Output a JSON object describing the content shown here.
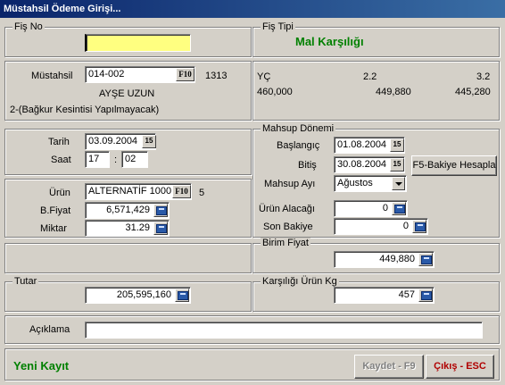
{
  "window": {
    "title": "Müstahsil Ödeme Girişi..."
  },
  "fis_no": {
    "legend": "Fiş No",
    "value": ""
  },
  "fis_tipi": {
    "legend": "Fiş Tipi",
    "value": "Mal Karşılığı"
  },
  "mustahsil": {
    "label": "Müstahsil",
    "code": "014-002",
    "lookup": "F10",
    "id": "1313",
    "name": "AYŞE UZUN",
    "note": "2-(Bağkur Kesintisi Yapılmayacak)"
  },
  "ratios": {
    "h1": "YÇ",
    "h2": "2.2",
    "h3": "3.2",
    "v1": "460,000",
    "v2": "449,880",
    "v3": "445,280"
  },
  "tarih": {
    "label": "Tarih",
    "value": "03.09.2004",
    "cal": "15"
  },
  "saat": {
    "label": "Saat",
    "hour": "17",
    "sep": ":",
    "minute": "02"
  },
  "mahsup": {
    "legend": "Mahsup Dönemi",
    "baslangic_label": "Başlangıç",
    "baslangic": "01.08.2004",
    "baslangic_cal": "15",
    "bitis_label": "Bitiş",
    "bitis": "30.08.2004",
    "bitis_cal": "15",
    "hesapla": "F5-Bakiye Hesapla",
    "ay_label": "Mahsup Ayı",
    "ay": "Ağustos",
    "alacagi_label": "Ürün Alacağı",
    "alacagi": "0",
    "bakiye_label": "Son Bakiye",
    "bakiye": "0"
  },
  "urun": {
    "label": "Ürün",
    "value": "ALTERNATİF 1000",
    "lookup": "F10",
    "code": "5",
    "bfiyat_label": "B.Fiyat",
    "bfiyat": "6,571,429",
    "miktar_label": "Miktar",
    "miktar": "31.29"
  },
  "birim_fiyat": {
    "legend": "Birim Fiyat",
    "value": "449,880"
  },
  "tutar": {
    "legend": "Tutar",
    "value": "205,595,160"
  },
  "karsiligi": {
    "legend": "Karşılığı Ürün Kg",
    "value": "457"
  },
  "aciklama": {
    "label": "Açıklama",
    "value": ""
  },
  "footer": {
    "status": "Yeni Kayıt",
    "save": "Kaydet - F9",
    "exit": "Çıkış - ESC"
  }
}
